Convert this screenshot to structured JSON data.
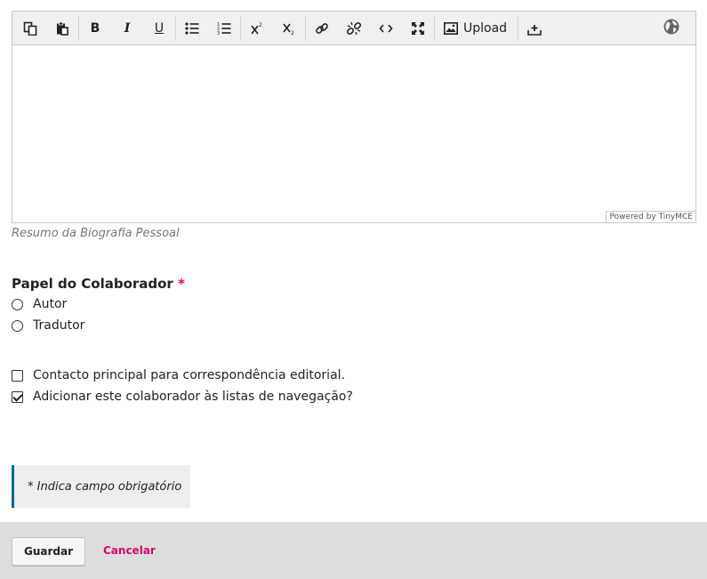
{
  "editor": {
    "toolbar": {
      "copy": "copy-icon",
      "paste": "paste-icon",
      "bold": "B",
      "italic": "I",
      "underline": "U",
      "bullet_list": "bullet-list-icon",
      "numbered_list": "numbered-list-icon",
      "superscript": "superscript-icon",
      "subscript": "subscript-icon",
      "link": "link-icon",
      "unlink": "unlink-icon",
      "code": "code-icon",
      "fullscreen": "fullscreen-icon",
      "upload_label": "Upload",
      "insert": "insert-icon",
      "language": "globe-icon"
    },
    "content": "",
    "powered_by": "Powered by TinyMCE"
  },
  "bio_description": "Resumo da Biografia Pessoal",
  "role": {
    "title": "Papel do Colaborador",
    "required_mark": "*",
    "options": [
      {
        "label": "Autor",
        "selected": false
      },
      {
        "label": "Tradutor",
        "selected": false
      }
    ]
  },
  "checkboxes": [
    {
      "label": "Contacto principal para correspondência editorial.",
      "checked": false
    },
    {
      "label": "Adicionar este colaborador às listas de navegação?",
      "checked": true
    }
  ],
  "required_notice": "* Indica campo obrigatório",
  "footer": {
    "save_label": "Guardar",
    "cancel_label": "Cancelar"
  },
  "colors": {
    "accent": "#d00a6c",
    "notice_border": "#006798"
  }
}
